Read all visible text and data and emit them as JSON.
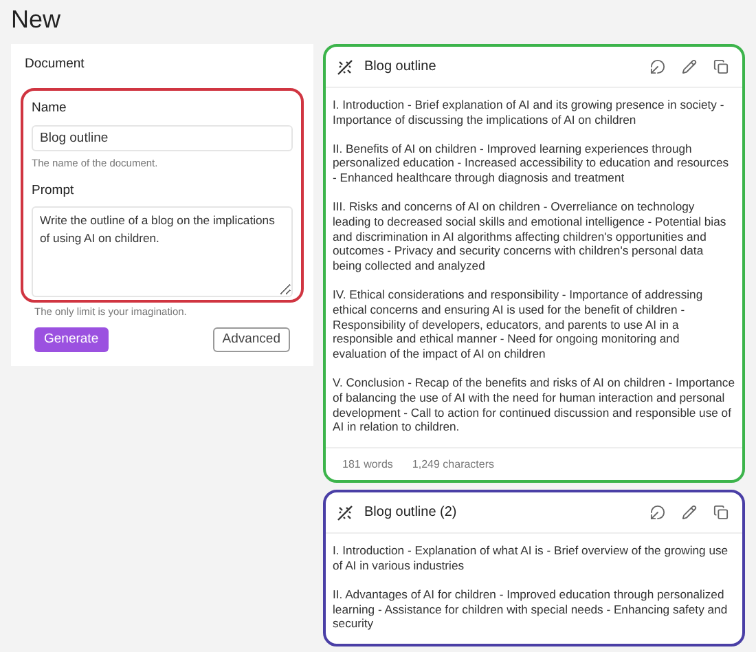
{
  "page_title": "New",
  "form": {
    "title": "Document",
    "name_label": "Name",
    "name_value": "Blog outline",
    "name_help": "The name of the document.",
    "prompt_label": "Prompt",
    "prompt_value": "Write the outline of a blog on the implications of using AI on children.",
    "prompt_help": "The only limit is your imagination.",
    "buttons": [
      "Generate",
      "Advanced"
    ]
  },
  "outputs": [
    {
      "title": "Blog outline",
      "color": "#3cb44b",
      "paragraphs": [
        "I. Introduction - Brief explanation of AI and its growing presence in society - Importance of discussing the implications of AI on children",
        "II. Benefits of AI on children - Improved learning experiences through personalized education - Increased accessibility to education and resources - Enhanced healthcare through diagnosis and treatment",
        "III. Risks and concerns of AI on children - Overreliance on technology leading to decreased social skills and emotional intelligence - Potential bias and discrimination in AI algorithms affecting children's opportunities and outcomes - Privacy and security concerns with children's personal data being collected and analyzed",
        "IV. Ethical considerations and responsibility - Importance of addressing ethical concerns and ensuring AI is used for the benefit of children - Responsibility of developers, educators, and parents to use AI in a responsible and ethical manner - Need for ongoing monitoring and evaluation of the impact of AI on children",
        "V. Conclusion - Recap of the benefits and risks of AI on children - Importance of balancing the use of AI with the need for human interaction and personal development - Call to action for continued discussion and responsible use of AI in relation to children."
      ],
      "words": "181 words",
      "characters": "1,249 characters"
    },
    {
      "title": "Blog outline (2)",
      "color": "#4a3fa6",
      "paragraphs": [
        "I. Introduction - Explanation of what AI is - Brief overview of the growing use of AI in various industries",
        "II. Advantages of AI for children - Improved education through personalized learning - Assistance for children with special needs - Enhancing safety and security"
      ]
    }
  ]
}
